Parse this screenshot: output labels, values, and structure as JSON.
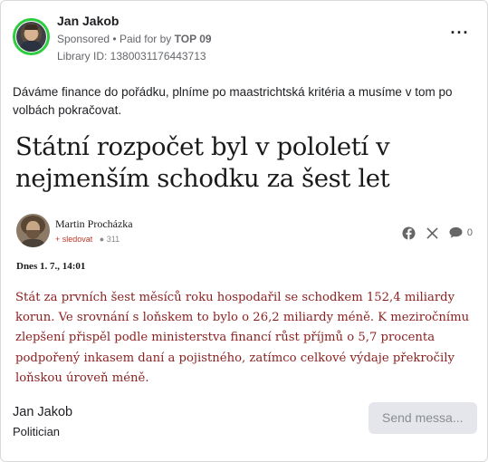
{
  "post": {
    "author": "Jan Jakob",
    "sponsored": "Sponsored",
    "separator": "•",
    "paid_for_by": "Paid for by",
    "payer": "TOP 09",
    "library_id": "Library ID: 1380031176443713",
    "more_icon": "more-horizontal-icon",
    "text": "Dáváme finance do pořádku, plníme po maastrichtská kritéria a musíme v tom po volbách pokračovat."
  },
  "article": {
    "headline": "Státní rozpočet byl v pololetí v nejmenším schodku za šest let",
    "author": "Martin Procházka",
    "follow": "+ sledovat",
    "followers": "311",
    "comments": "0",
    "date": "Dnes 1. 7., 14:01",
    "lead": "Stát za prvních šest měsíců roku hospodařil se schodkem 152,4 miliardy korun. Ve srovnání s loňskem to bylo o 26,2 miliardy méně. K meziročnímu zlepšení přispěl podle ministerstva financí růst příjmů o 5,7 procenta podpořený inkasem daní a pojistného, zatímco celkové výdaje překročily loňskou úroveň méně."
  },
  "footer": {
    "name": "Jan Jakob",
    "role": "Politician",
    "send_button": "Send messa..."
  },
  "colors": {
    "avatar_ring": "#2ecc40",
    "lead_text": "#8a1f1f",
    "follow": "#c0392b"
  }
}
